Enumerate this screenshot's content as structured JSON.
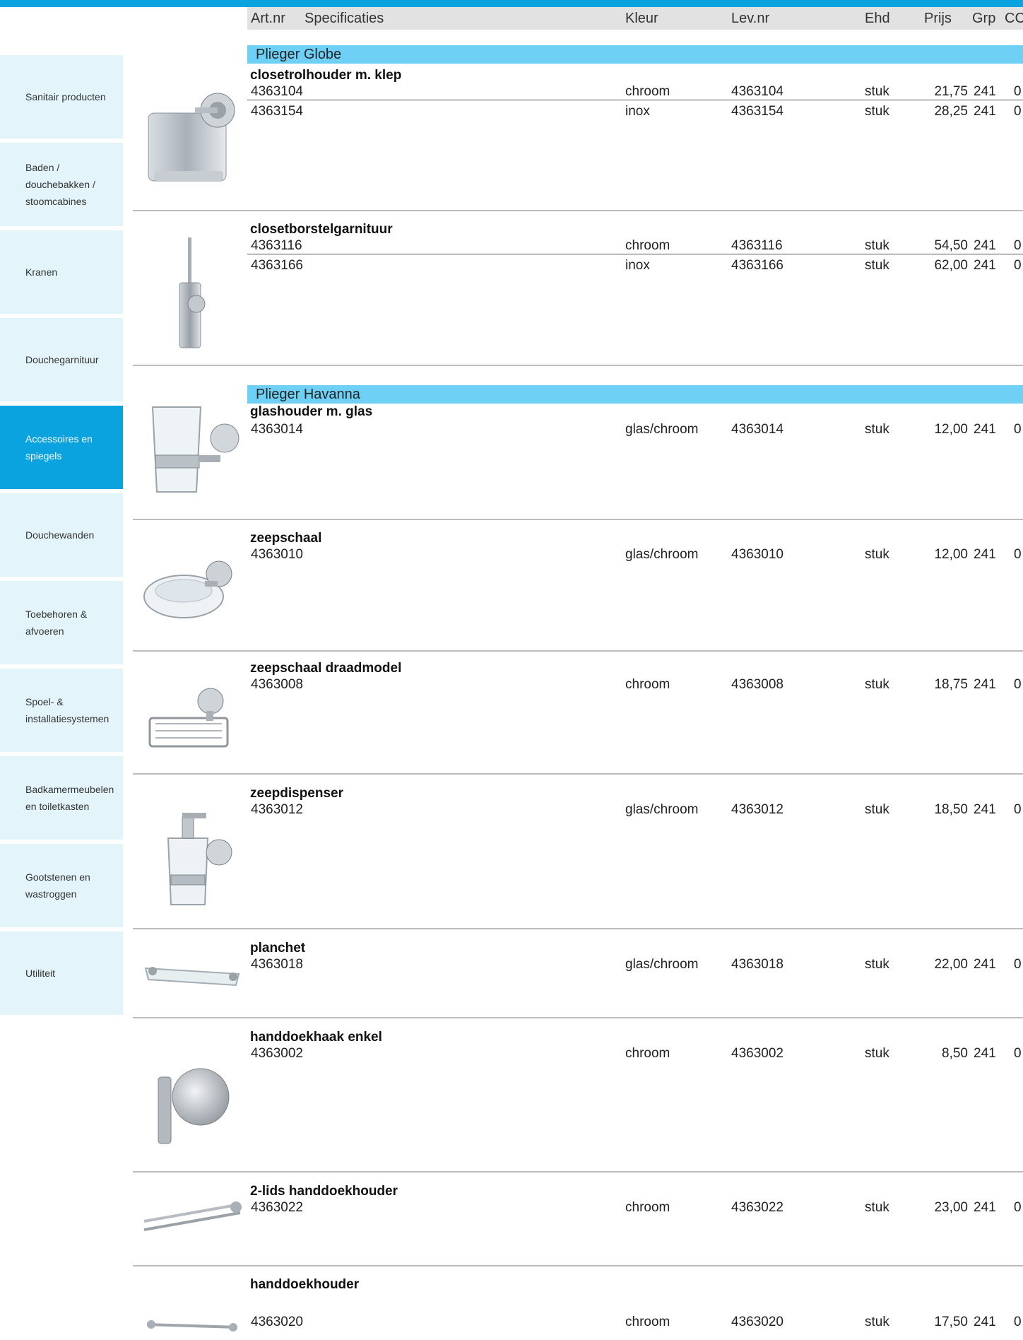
{
  "header": {
    "art_nr": "Art.nr",
    "specificaties": "Specificaties",
    "kleur": "Kleur",
    "lev_nr": "Lev.nr",
    "ehd": "Ehd",
    "prijs": "Prijs",
    "grp": "Grp",
    "cc": "CC"
  },
  "sidebar": {
    "items": [
      {
        "label": "Sanitair producten"
      },
      {
        "label": "Baden /\ndouchebakken /\nstoomcabines"
      },
      {
        "label": "Kranen"
      },
      {
        "label": "Douchegarnituur"
      },
      {
        "label": "Accessoires en\nspiegels"
      },
      {
        "label": "Douchewanden"
      },
      {
        "label": "Toebehoren &\nafvoeren"
      },
      {
        "label": "Spoel- &\ninstallatiesystemen"
      },
      {
        "label": "Badkamermeubelen\nen toiletkasten"
      },
      {
        "label": "Gootstenen en\nwastroggen"
      },
      {
        "label": "Utiliteit"
      }
    ]
  },
  "sections": [
    {
      "title": "Plieger Globe"
    },
    {
      "title": "Plieger Havanna"
    }
  ],
  "products": [
    {
      "title": "closetrolhouder m. klep",
      "rows": [
        {
          "art": "4363104",
          "kleur": "chroom",
          "lev": "4363104",
          "ehd": "stuk",
          "prijs": "21,75",
          "grp": "241",
          "cc": "0"
        },
        {
          "art": "4363154",
          "kleur": "inox",
          "lev": "4363154",
          "ehd": "stuk",
          "prijs": "28,25",
          "grp": "241",
          "cc": "0"
        }
      ]
    },
    {
      "title": "closetborstelgarnituur",
      "rows": [
        {
          "art": "4363116",
          "kleur": "chroom",
          "lev": "4363116",
          "ehd": "stuk",
          "prijs": "54,50",
          "grp": "241",
          "cc": "0"
        },
        {
          "art": "4363166",
          "kleur": "inox",
          "lev": "4363166",
          "ehd": "stuk",
          "prijs": "62,00",
          "grp": "241",
          "cc": "0"
        }
      ]
    },
    {
      "title": "glashouder m. glas",
      "rows": [
        {
          "art": "4363014",
          "kleur": "glas/chroom",
          "lev": "4363014",
          "ehd": "stuk",
          "prijs": "12,00",
          "grp": "241",
          "cc": "0"
        }
      ]
    },
    {
      "title": "zeepschaal",
      "rows": [
        {
          "art": "4363010",
          "kleur": "glas/chroom",
          "lev": "4363010",
          "ehd": "stuk",
          "prijs": "12,00",
          "grp": "241",
          "cc": "0"
        }
      ]
    },
    {
      "title": "zeepschaal draadmodel",
      "rows": [
        {
          "art": "4363008",
          "kleur": "chroom",
          "lev": "4363008",
          "ehd": "stuk",
          "prijs": "18,75",
          "grp": "241",
          "cc": "0"
        }
      ]
    },
    {
      "title": "zeepdispenser",
      "rows": [
        {
          "art": "4363012",
          "kleur": "glas/chroom",
          "lev": "4363012",
          "ehd": "stuk",
          "prijs": "18,50",
          "grp": "241",
          "cc": "0"
        }
      ]
    },
    {
      "title": "planchet",
      "rows": [
        {
          "art": "4363018",
          "kleur": "glas/chroom",
          "lev": "4363018",
          "ehd": "stuk",
          "prijs": "22,00",
          "grp": "241",
          "cc": "0"
        }
      ]
    },
    {
      "title": "handdoekhaak enkel",
      "rows": [
        {
          "art": "4363002",
          "kleur": "chroom",
          "lev": "4363002",
          "ehd": "stuk",
          "prijs": "8,50",
          "grp": "241",
          "cc": "0"
        }
      ]
    },
    {
      "title": "2-lids handdoekhouder",
      "rows": [
        {
          "art": "4363022",
          "kleur": "chroom",
          "lev": "4363022",
          "ehd": "stuk",
          "prijs": "23,00",
          "grp": "241",
          "cc": "0"
        }
      ]
    },
    {
      "title": "handdoekhouder",
      "rows": [
        {
          "art": "4363020",
          "kleur": "chroom",
          "lev": "4363020",
          "ehd": "stuk",
          "prijs": "17,50",
          "grp": "241",
          "cc": "0"
        }
      ]
    }
  ],
  "colors": {
    "accent": "#0aa3e0",
    "section_bar": "#6fd0f5",
    "sidebar_bg": "#e3f4fb",
    "header_bg": "#e2e2e2"
  }
}
